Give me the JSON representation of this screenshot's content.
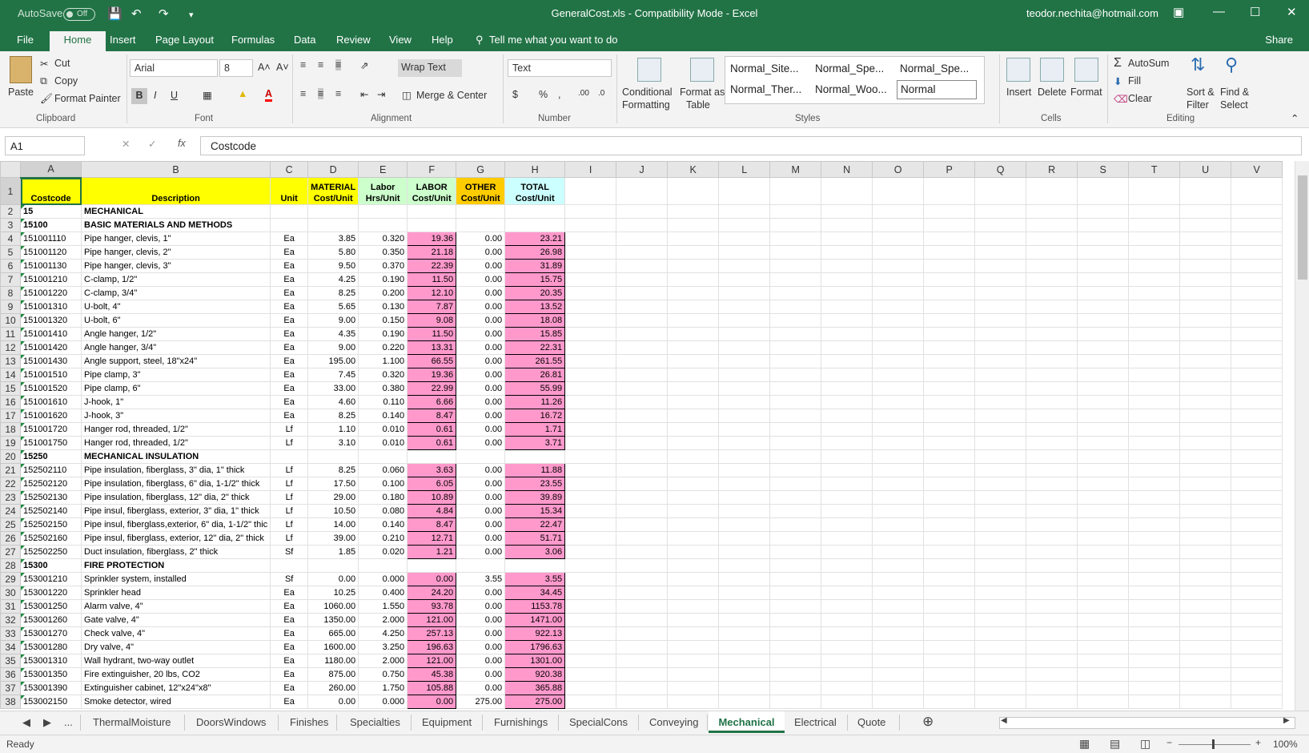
{
  "titlebar": {
    "autosave": "AutoSave",
    "autosave_state": "Off",
    "title": "GeneralCost.xls  -  Compatibility Mode  -  Excel",
    "user": "teodor.nechita@hotmail.com"
  },
  "menu": {
    "tabs": [
      "File",
      "Home",
      "Insert",
      "Page Layout",
      "Formulas",
      "Data",
      "Review",
      "View",
      "Help"
    ],
    "tell_me": "Tell me what you want to do",
    "share": "Share"
  },
  "ribbon": {
    "clipboard": {
      "paste": "Paste",
      "cut": "Cut",
      "copy": "Copy",
      "format_painter": "Format Painter",
      "label": "Clipboard"
    },
    "font": {
      "name": "Arial",
      "size": "8",
      "bold": "B",
      "italic": "I",
      "underline": "U",
      "label": "Font"
    },
    "alignment": {
      "wrap": "Wrap Text",
      "merge": "Merge & Center",
      "label": "Alignment"
    },
    "number": {
      "format": "Text",
      "label": "Number"
    },
    "styles": {
      "conditional": "Conditional",
      "conditional2": "Formatting",
      "format_as": "Format as",
      "format_as2": "Table",
      "items": [
        "Normal_Site...",
        "Normal_Spe...",
        "Normal_Spe...",
        "Normal_Ther...",
        "Normal_Woo...",
        "Normal"
      ],
      "label": "Styles"
    },
    "cells": {
      "insert": "Insert",
      "delete": "Delete",
      "format": "Format",
      "label": "Cells"
    },
    "editing": {
      "autosum": "AutoSum",
      "fill": "Fill",
      "clear": "Clear",
      "sort": "Sort &",
      "sort2": "Filter",
      "find": "Find &",
      "find2": "Select",
      "label": "Editing"
    }
  },
  "formula_bar": {
    "name_box": "A1",
    "formula": "Costcode"
  },
  "columns": [
    "A",
    "B",
    "C",
    "D",
    "E",
    "F",
    "G",
    "H",
    "I",
    "J",
    "K",
    "L",
    "M",
    "N",
    "O",
    "P",
    "Q",
    "R",
    "S",
    "T",
    "U",
    "V"
  ],
  "header_row": {
    "a": "Costcode",
    "b": "Description",
    "c": "Unit",
    "d1": "MATERIAL",
    "d2": "Cost/Unit",
    "e1": "Labor",
    "e2": "Hrs/Unit",
    "f1": "LABOR",
    "f2": "Cost/Unit",
    "g1": "OTHER",
    "g2": "Cost/Unit",
    "h1": "TOTAL",
    "h2": "Cost/Unit"
  },
  "rows": [
    {
      "n": "2",
      "a": "15",
      "b": "MECHANICAL",
      "section": true
    },
    {
      "n": "3",
      "a": "15100",
      "b": "BASIC MATERIALS AND METHODS",
      "section": true
    },
    {
      "n": "4",
      "a": "151001110",
      "b": "Pipe hanger, clevis, 1\"",
      "c": "Ea",
      "d": "3.85",
      "e": "0.320",
      "f": "19.36",
      "g": "0.00",
      "h": "23.21"
    },
    {
      "n": "5",
      "a": "151001120",
      "b": "Pipe hanger, clevis, 2\"",
      "c": "Ea",
      "d": "5.80",
      "e": "0.350",
      "f": "21.18",
      "g": "0.00",
      "h": "26.98"
    },
    {
      "n": "6",
      "a": "151001130",
      "b": "Pipe hanger, clevis, 3\"",
      "c": "Ea",
      "d": "9.50",
      "e": "0.370",
      "f": "22.39",
      "g": "0.00",
      "h": "31.89"
    },
    {
      "n": "7",
      "a": "151001210",
      "b": "C-clamp, 1/2\"",
      "c": "Ea",
      "d": "4.25",
      "e": "0.190",
      "f": "11.50",
      "g": "0.00",
      "h": "15.75"
    },
    {
      "n": "8",
      "a": "151001220",
      "b": "C-clamp, 3/4\"",
      "c": "Ea",
      "d": "8.25",
      "e": "0.200",
      "f": "12.10",
      "g": "0.00",
      "h": "20.35"
    },
    {
      "n": "9",
      "a": "151001310",
      "b": "U-bolt, 4\"",
      "c": "Ea",
      "d": "5.65",
      "e": "0.130",
      "f": "7.87",
      "g": "0.00",
      "h": "13.52"
    },
    {
      "n": "10",
      "a": "151001320",
      "b": "U-bolt, 6\"",
      "c": "Ea",
      "d": "9.00",
      "e": "0.150",
      "f": "9.08",
      "g": "0.00",
      "h": "18.08"
    },
    {
      "n": "11",
      "a": "151001410",
      "b": "Angle hanger, 1/2\"",
      "c": "Ea",
      "d": "4.35",
      "e": "0.190",
      "f": "11.50",
      "g": "0.00",
      "h": "15.85"
    },
    {
      "n": "12",
      "a": "151001420",
      "b": "Angle hanger, 3/4\"",
      "c": "Ea",
      "d": "9.00",
      "e": "0.220",
      "f": "13.31",
      "g": "0.00",
      "h": "22.31"
    },
    {
      "n": "13",
      "a": "151001430",
      "b": "Angle support, steel, 18\"x24\"",
      "c": "Ea",
      "d": "195.00",
      "e": "1.100",
      "f": "66.55",
      "g": "0.00",
      "h": "261.55"
    },
    {
      "n": "14",
      "a": "151001510",
      "b": "Pipe clamp, 3\"",
      "c": "Ea",
      "d": "7.45",
      "e": "0.320",
      "f": "19.36",
      "g": "0.00",
      "h": "26.81"
    },
    {
      "n": "15",
      "a": "151001520",
      "b": "Pipe clamp, 6\"",
      "c": "Ea",
      "d": "33.00",
      "e": "0.380",
      "f": "22.99",
      "g": "0.00",
      "h": "55.99"
    },
    {
      "n": "16",
      "a": "151001610",
      "b": "J-hook, 1\"",
      "c": "Ea",
      "d": "4.60",
      "e": "0.110",
      "f": "6.66",
      "g": "0.00",
      "h": "11.26"
    },
    {
      "n": "17",
      "a": "151001620",
      "b": "J-hook, 3\"",
      "c": "Ea",
      "d": "8.25",
      "e": "0.140",
      "f": "8.47",
      "g": "0.00",
      "h": "16.72"
    },
    {
      "n": "18",
      "a": "151001720",
      "b": "Hanger rod, threaded, 1/2\"",
      "c": "Lf",
      "d": "1.10",
      "e": "0.010",
      "f": "0.61",
      "g": "0.00",
      "h": "1.71"
    },
    {
      "n": "19",
      "a": "151001750",
      "b": "Hanger rod, threaded, 1/2\"",
      "c": "Lf",
      "d": "3.10",
      "e": "0.010",
      "f": "0.61",
      "g": "0.00",
      "h": "3.71"
    },
    {
      "n": "20",
      "a": "15250",
      "b": "MECHANICAL INSULATION",
      "section": true
    },
    {
      "n": "21",
      "a": "152502110",
      "b": "Pipe insulation, fiberglass, 3\" dia, 1\" thick",
      "c": "Lf",
      "d": "8.25",
      "e": "0.060",
      "f": "3.63",
      "g": "0.00",
      "h": "11.88"
    },
    {
      "n": "22",
      "a": "152502120",
      "b": "Pipe insulation, fiberglass, 6\" dia, 1-1/2\" thick",
      "c": "Lf",
      "d": "17.50",
      "e": "0.100",
      "f": "6.05",
      "g": "0.00",
      "h": "23.55"
    },
    {
      "n": "23",
      "a": "152502130",
      "b": "Pipe insulation, fiberglass, 12\" dia, 2\" thick",
      "c": "Lf",
      "d": "29.00",
      "e": "0.180",
      "f": "10.89",
      "g": "0.00",
      "h": "39.89"
    },
    {
      "n": "24",
      "a": "152502140",
      "b": "Pipe insul, fiberglass, exterior, 3\" dia, 1\" thick",
      "c": "Lf",
      "d": "10.50",
      "e": "0.080",
      "f": "4.84",
      "g": "0.00",
      "h": "15.34"
    },
    {
      "n": "25",
      "a": "152502150",
      "b": "Pipe insul, fiberglass,exterior, 6\" dia, 1-1/2\" thic",
      "c": "Lf",
      "d": "14.00",
      "e": "0.140",
      "f": "8.47",
      "g": "0.00",
      "h": "22.47"
    },
    {
      "n": "26",
      "a": "152502160",
      "b": "Pipe insul, fiberglass, exterior, 12\" dia, 2\" thick",
      "c": "Lf",
      "d": "39.00",
      "e": "0.210",
      "f": "12.71",
      "g": "0.00",
      "h": "51.71"
    },
    {
      "n": "27",
      "a": "152502250",
      "b": "Duct insulation, fiberglass, 2\" thick",
      "c": "Sf",
      "d": "1.85",
      "e": "0.020",
      "f": "1.21",
      "g": "0.00",
      "h": "3.06"
    },
    {
      "n": "28",
      "a": "15300",
      "b": "FIRE PROTECTION",
      "section": true
    },
    {
      "n": "29",
      "a": "153001210",
      "b": "Sprinkler system, installed",
      "c": "Sf",
      "d": "0.00",
      "e": "0.000",
      "f": "0.00",
      "g": "3.55",
      "h": "3.55"
    },
    {
      "n": "30",
      "a": "153001220",
      "b": "Sprinkler head",
      "c": "Ea",
      "d": "10.25",
      "e": "0.400",
      "f": "24.20",
      "g": "0.00",
      "h": "34.45"
    },
    {
      "n": "31",
      "a": "153001250",
      "b": "Alarm valve, 4\"",
      "c": "Ea",
      "d": "1060.00",
      "e": "1.550",
      "f": "93.78",
      "g": "0.00",
      "h": "1153.78"
    },
    {
      "n": "32",
      "a": "153001260",
      "b": "Gate valve, 4\"",
      "c": "Ea",
      "d": "1350.00",
      "e": "2.000",
      "f": "121.00",
      "g": "0.00",
      "h": "1471.00"
    },
    {
      "n": "33",
      "a": "153001270",
      "b": "Check valve, 4\"",
      "c": "Ea",
      "d": "665.00",
      "e": "4.250",
      "f": "257.13",
      "g": "0.00",
      "h": "922.13"
    },
    {
      "n": "34",
      "a": "153001280",
      "b": "Dry valve, 4\"",
      "c": "Ea",
      "d": "1600.00",
      "e": "3.250",
      "f": "196.63",
      "g": "0.00",
      "h": "1796.63"
    },
    {
      "n": "35",
      "a": "153001310",
      "b": "Wall hydrant, two-way outlet",
      "c": "Ea",
      "d": "1180.00",
      "e": "2.000",
      "f": "121.00",
      "g": "0.00",
      "h": "1301.00"
    },
    {
      "n": "36",
      "a": "153001350",
      "b": "Fire extinguisher, 20 lbs, CO2",
      "c": "Ea",
      "d": "875.00",
      "e": "0.750",
      "f": "45.38",
      "g": "0.00",
      "h": "920.38"
    },
    {
      "n": "37",
      "a": "153001390",
      "b": "Extinguisher cabinet, 12\"x24\"x8\"",
      "c": "Ea",
      "d": "260.00",
      "e": "1.750",
      "f": "105.88",
      "g": "0.00",
      "h": "365.88"
    },
    {
      "n": "38",
      "a": "153002150",
      "b": "Smoke detector, wired",
      "c": "Ea",
      "d": "0.00",
      "e": "0.000",
      "f": "0.00",
      "g": "275.00",
      "h": "275.00"
    }
  ],
  "sheet_tabs": [
    "ThermalMoisture",
    "DoorsWindows",
    "Finishes",
    "Specialties",
    "Equipment",
    "Furnishings",
    "SpecialCons",
    "Conveying",
    "Mechanical",
    "Electrical",
    "Quote"
  ],
  "sheet_more": "...",
  "status": {
    "ready": "Ready",
    "zoom": "100%"
  }
}
